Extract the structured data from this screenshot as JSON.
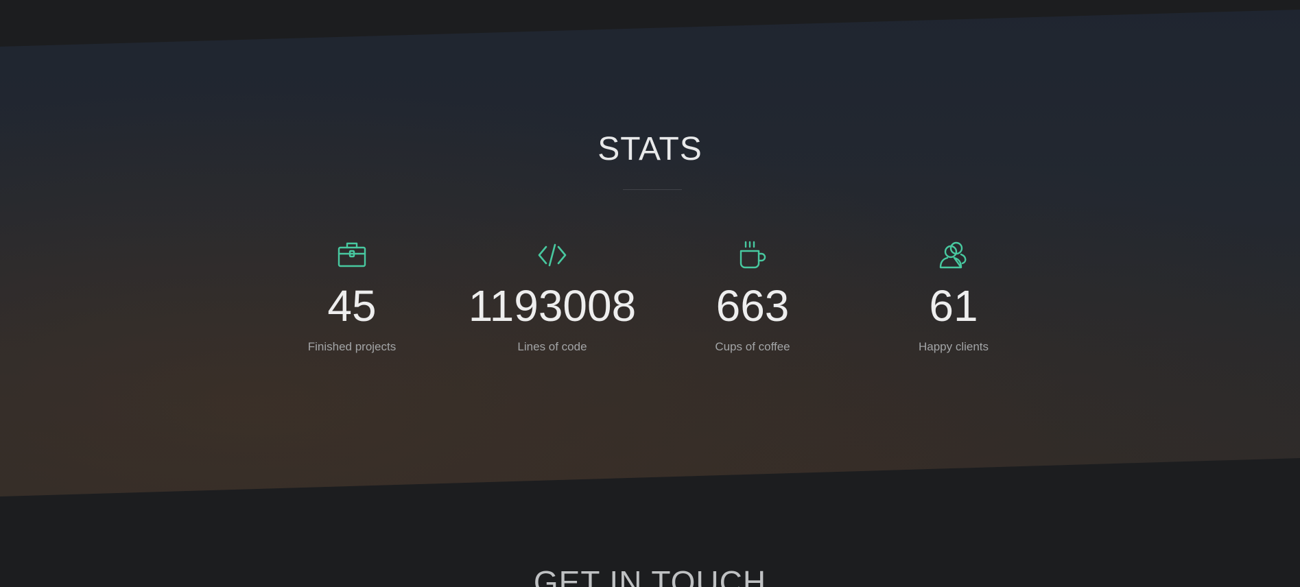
{
  "stats": {
    "title": "STATS",
    "items": [
      {
        "icon": "briefcase-icon",
        "value": "45",
        "label": "Finished projects"
      },
      {
        "icon": "code-icon",
        "value": "1193008",
        "label": "Lines of code"
      },
      {
        "icon": "coffee-cup-icon",
        "value": "663",
        "label": "Cups of coffee"
      },
      {
        "icon": "users-icon",
        "value": "61",
        "label": "Happy clients"
      }
    ]
  },
  "contact": {
    "title": "GET IN TOUCH"
  },
  "colors": {
    "accent": "#48c9a0",
    "background": "#1c1d1f",
    "text": "#eeeeee",
    "muted_text": "#a3a5a7"
  }
}
